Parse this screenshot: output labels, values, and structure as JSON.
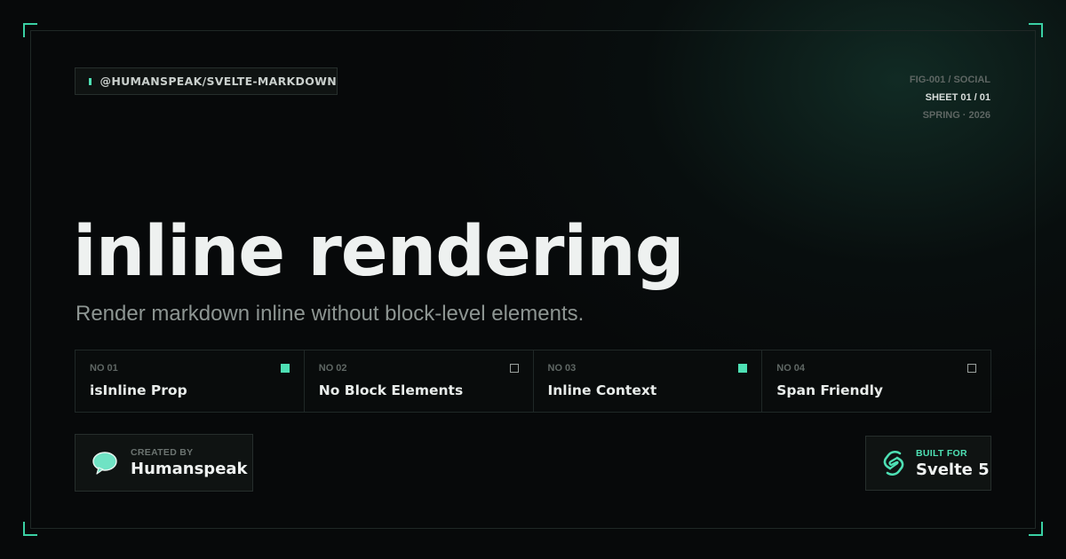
{
  "package": {
    "name": "@HUMANSPEAK/SVELTE-MARKDOWN"
  },
  "meta": {
    "fig": "FIG-001 / SOCIAL",
    "sheet": "SHEET 01 / 01",
    "season": "SPRING · 2026"
  },
  "hero": {
    "title": "inline rendering",
    "subtitle": "Render markdown inline without block-level elements."
  },
  "features": [
    {
      "no": "NO 01",
      "label": "isInline Prop",
      "marker": "filled"
    },
    {
      "no": "NO 02",
      "label": "No Block Elements",
      "marker": "empty"
    },
    {
      "no": "NO 03",
      "label": "Inline Context",
      "marker": "filled"
    },
    {
      "no": "NO 04",
      "label": "Span Friendly",
      "marker": "empty"
    }
  ],
  "creator": {
    "caption": "CREATED BY",
    "name": "Humanspeak",
    "icon": "speech-bubble-icon"
  },
  "built_for": {
    "caption": "BUILT FOR",
    "name": "Svelte 5",
    "icon": "svelte-logo-icon"
  },
  "colors": {
    "accent": "#4ee0b4",
    "background": "#07090a"
  }
}
